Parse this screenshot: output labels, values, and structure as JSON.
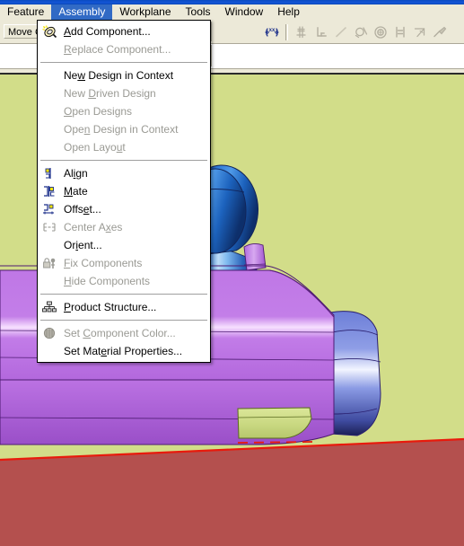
{
  "window": {
    "title_bar_color": "#0b4ccc",
    "chrome_color": "#ece9d8"
  },
  "menubar": {
    "items": [
      {
        "label": "Feature",
        "selected": false
      },
      {
        "label": "Assembly",
        "selected": true
      },
      {
        "label": "Workplane",
        "selected": false
      },
      {
        "label": "Tools",
        "selected": false
      },
      {
        "label": "Window",
        "selected": false
      },
      {
        "label": "Help",
        "selected": false
      }
    ],
    "highlight_color": "#316ac5"
  },
  "toolbar": {
    "move_button_label": "Move C",
    "icons": [
      {
        "name": "move-component-icon",
        "enabled": true
      },
      {
        "name": "point-icon",
        "enabled": false
      },
      {
        "name": "corner-icon",
        "enabled": false
      },
      {
        "name": "line-icon",
        "enabled": false
      },
      {
        "name": "arc-icon",
        "enabled": false
      },
      {
        "name": "circle-icon",
        "enabled": false
      },
      {
        "name": "equal-constraint-icon",
        "enabled": false
      },
      {
        "name": "angle-constraint-icon",
        "enabled": false
      },
      {
        "name": "dimension-icon",
        "enabled": false
      }
    ]
  },
  "assembly_menu": {
    "groups": [
      {
        "items": [
          {
            "label": "Add Component...",
            "accel": "A",
            "enabled": true,
            "icon": "add-component-icon"
          },
          {
            "label": "Replace Component...",
            "accel": "R",
            "enabled": false,
            "icon": "none"
          }
        ]
      },
      {
        "items": [
          {
            "label": "New Design in Context",
            "accel": "w",
            "enabled": true,
            "icon": "none"
          },
          {
            "label": "New Driven Design",
            "accel": "D",
            "enabled": false,
            "icon": "none"
          },
          {
            "label": "Open Designs",
            "accel": "O",
            "enabled": false,
            "icon": "none"
          },
          {
            "label": "Open Design in Context",
            "accel": "n",
            "enabled": false,
            "icon": "none"
          },
          {
            "label": "Open Layout",
            "accel": "u",
            "enabled": false,
            "icon": "none"
          }
        ]
      },
      {
        "items": [
          {
            "label": "Align",
            "accel": "i",
            "enabled": true,
            "icon": "align-icon"
          },
          {
            "label": "Mate",
            "accel": "M",
            "enabled": true,
            "icon": "mate-icon"
          },
          {
            "label": "Offset...",
            "accel": "e",
            "enabled": true,
            "icon": "offset-icon"
          },
          {
            "label": "Center Axes",
            "accel": "x",
            "enabled": false,
            "icon": "center-axes-icon"
          },
          {
            "label": "Orient...",
            "accel": "i",
            "enabled": true,
            "icon": "none"
          },
          {
            "label": "Fix Components",
            "accel": "F",
            "enabled": false,
            "icon": "fix-components-icon"
          },
          {
            "label": "Hide Components",
            "accel": "H",
            "enabled": false,
            "icon": "none"
          }
        ]
      },
      {
        "items": [
          {
            "label": "Product Structure...",
            "accel": "P",
            "enabled": true,
            "icon": "product-structure-icon"
          }
        ]
      },
      {
        "items": [
          {
            "label": "Set Component Color...",
            "accel": "C",
            "enabled": false,
            "icon": "set-color-icon"
          },
          {
            "label": "Set Material Properties...",
            "accel": "e",
            "enabled": true,
            "icon": "none"
          }
        ]
      }
    ]
  },
  "viewport": {
    "background_color": "#d2dd89",
    "floor_color": "#b4504e",
    "floor_edge_color": "#e81a0c",
    "body_color": "#b86de0",
    "body_highlight_color": "#f3d4ff",
    "boss_color": "#7d7de0",
    "sphere_color": "#1f6fd0",
    "pad_color": "#c7d77e",
    "edge_color": "#3a1a5a"
  }
}
